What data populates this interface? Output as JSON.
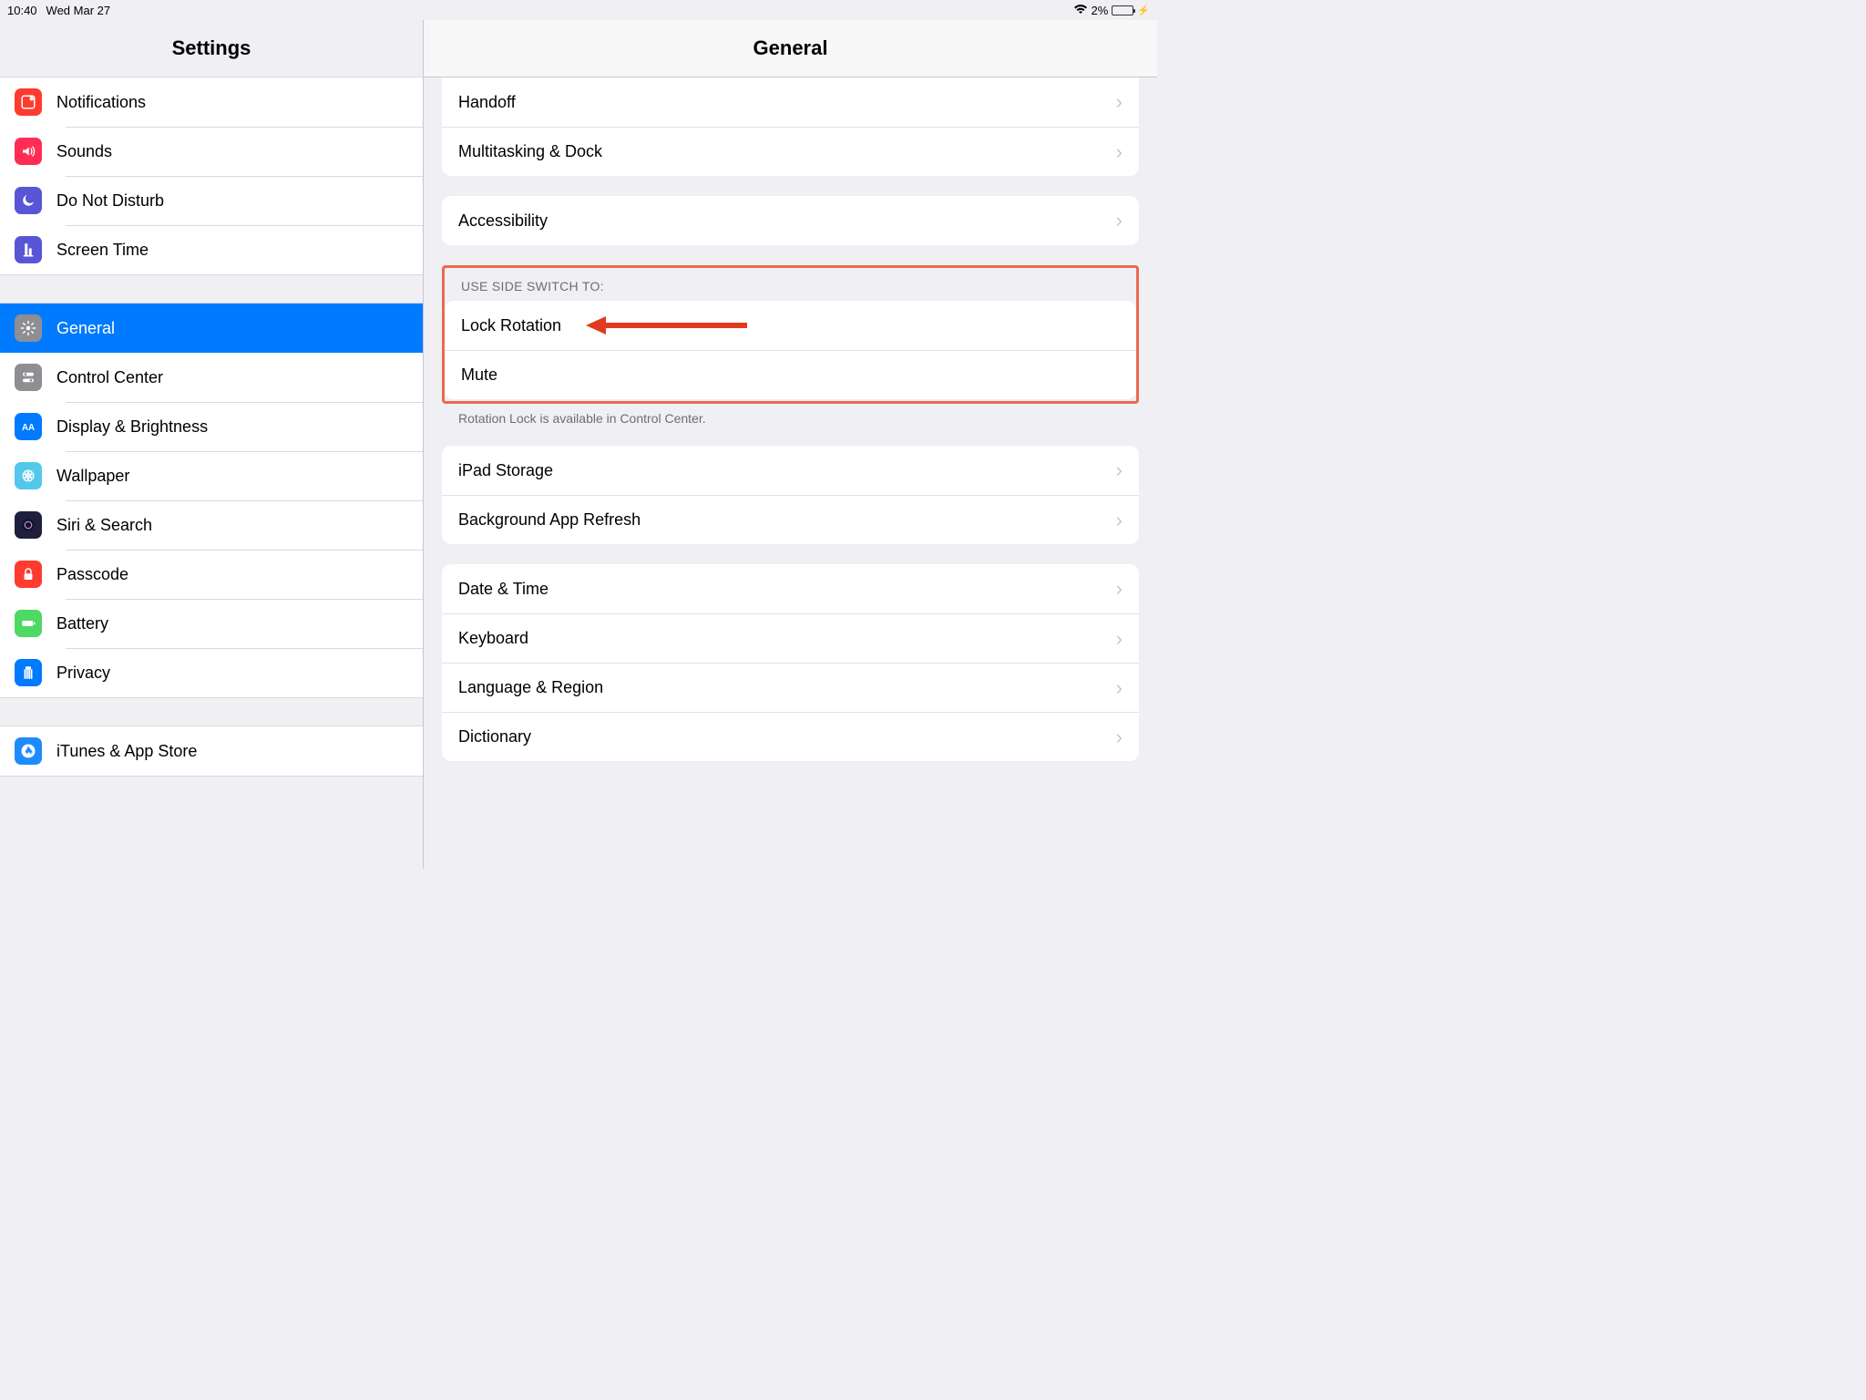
{
  "status": {
    "time": "10:40",
    "date": "Wed Mar 27",
    "battery_pct": "2%"
  },
  "sidebar": {
    "title": "Settings",
    "groups": [
      [
        {
          "label": "Notifications",
          "icon": "notifications",
          "color": "#ff3b30"
        },
        {
          "label": "Sounds",
          "icon": "sounds",
          "color": "#ff2d55"
        },
        {
          "label": "Do Not Disturb",
          "icon": "dnd",
          "color": "#5856d6"
        },
        {
          "label": "Screen Time",
          "icon": "screentime",
          "color": "#5856d6"
        }
      ],
      [
        {
          "label": "General",
          "icon": "general",
          "color": "#8e8e93",
          "selected": true
        },
        {
          "label": "Control Center",
          "icon": "controlcenter",
          "color": "#8e8e93"
        },
        {
          "label": "Display & Brightness",
          "icon": "display",
          "color": "#007aff"
        },
        {
          "label": "Wallpaper",
          "icon": "wallpaper",
          "color": "#54c7ec"
        },
        {
          "label": "Siri & Search",
          "icon": "siri",
          "color": "#1f1f3d"
        },
        {
          "label": "Passcode",
          "icon": "passcode",
          "color": "#ff3b30"
        },
        {
          "label": "Battery",
          "icon": "battery",
          "color": "#4cd964"
        },
        {
          "label": "Privacy",
          "icon": "privacy",
          "color": "#007aff"
        }
      ],
      [
        {
          "label": "iTunes & App Store",
          "icon": "appstore",
          "color": "#1e8bff"
        }
      ]
    ]
  },
  "detail": {
    "title": "General",
    "sections": [
      {
        "rows": [
          "Handoff",
          "Multitasking & Dock"
        ],
        "top": true
      },
      {
        "rows": [
          "Accessibility"
        ]
      },
      {
        "header": "Use Side Switch To:",
        "rows_nochev": [
          "Lock Rotation",
          "Mute"
        ],
        "footer": "Rotation Lock is available in Control Center.",
        "highlighted": true,
        "arrow_on": 0
      },
      {
        "rows": [
          "iPad Storage",
          "Background App Refresh"
        ]
      },
      {
        "rows": [
          "Date & Time",
          "Keyboard",
          "Language & Region",
          "Dictionary"
        ]
      }
    ]
  }
}
